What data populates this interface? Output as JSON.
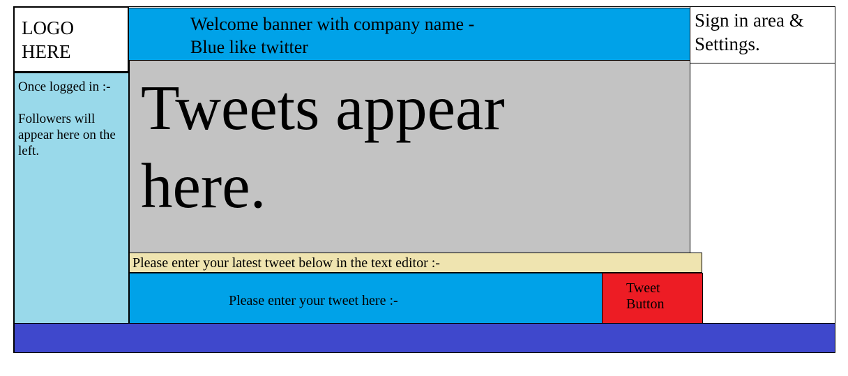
{
  "logo": {
    "text": "LOGO\nHERE"
  },
  "banner": {
    "text": "Welcome banner with company name -\nBlue like twitter"
  },
  "signin": {
    "text": "Sign in area &\nSettings."
  },
  "sidebar": {
    "line1": "Once logged in :-",
    "line2": "Followers will appear here on the left."
  },
  "feed": {
    "text": "Tweets appear\nhere."
  },
  "prompt": {
    "text": "Please enter your latest tweet below in the text editor :-"
  },
  "editor": {
    "text": "Please enter your tweet here :-"
  },
  "tweet_button": {
    "text": "Tweet\nButton"
  },
  "colors": {
    "banner_blue": "#00a2e8",
    "sidebar_light_blue": "#99d9ea",
    "feed_gray": "#c3c3c3",
    "prompt_tan": "#efe4b0",
    "button_red": "#ed1c24",
    "footer_indigo": "#3f48cc"
  }
}
